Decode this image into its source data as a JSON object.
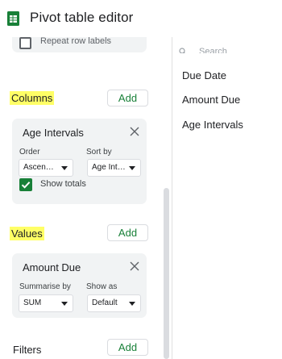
{
  "header": {
    "title": "Pivot table editor",
    "icon": "sheets-icon"
  },
  "rows_section": {
    "repeat_row_labels": "Repeat row labels",
    "repeat_checked": false
  },
  "columns_section": {
    "label": "Columns",
    "add_label": "Add",
    "card": {
      "title": "Age Intervals",
      "order_label": "Order",
      "order_value": "Ascen…",
      "sortby_label": "Sort by",
      "sortby_value": "Age Int…",
      "show_totals_label": "Show totals",
      "show_totals_checked": true
    }
  },
  "values_section": {
    "label": "Values",
    "add_label": "Add",
    "card": {
      "title": "Amount Due",
      "summarise_label": "Summarise by",
      "summarise_value": "SUM",
      "showas_label": "Show as",
      "showas_value": "Default"
    }
  },
  "filters_section": {
    "label": "Filters",
    "add_label": "Add"
  },
  "fields_panel": {
    "search_placeholder": "Search",
    "items": [
      "Due Date",
      "Amount Due",
      "Age Intervals"
    ]
  },
  "colors": {
    "accent_green": "#188038",
    "highlight": "#ffff66",
    "card_bg": "#f1f3f4"
  }
}
